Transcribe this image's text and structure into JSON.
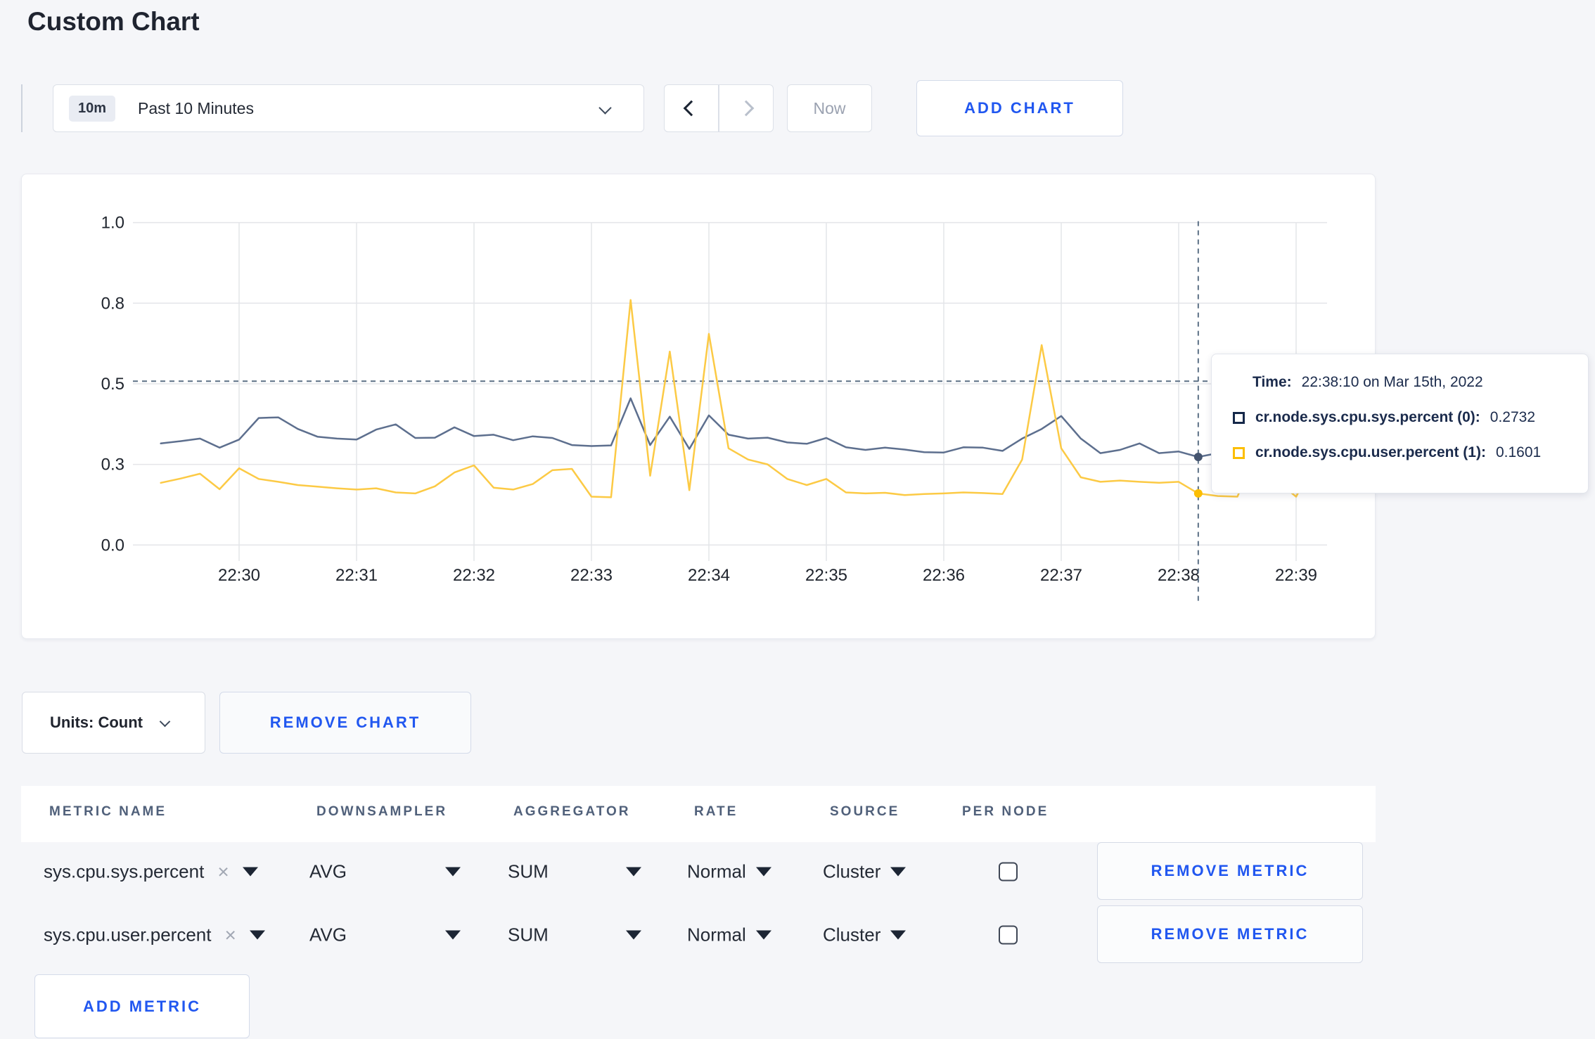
{
  "page": {
    "title": "Custom Chart"
  },
  "toolbar": {
    "time_badge": "10m",
    "time_label": "Past 10 Minutes",
    "now_label": "Now",
    "add_chart_label": "ADD CHART"
  },
  "chart_controls": {
    "units_label": "Units: Count",
    "remove_chart_label": "REMOVE CHART"
  },
  "tooltip": {
    "time_label": "Time:",
    "time_value": "22:38:10 on Mar 15th, 2022",
    "series": [
      {
        "name": "cr.node.sys.cpu.sys.percent (0):",
        "value": "0.2732",
        "color": "#152849"
      },
      {
        "name": "cr.node.sys.cpu.user.percent (1):",
        "value": "0.1601",
        "color": "#fcbe03"
      }
    ]
  },
  "metrics_table": {
    "headers": [
      "METRIC NAME",
      "DOWNSAMPLER",
      "AGGREGATOR",
      "RATE",
      "SOURCE",
      "PER NODE"
    ],
    "rows": [
      {
        "name": "sys.cpu.sys.percent",
        "remove_icon": "×",
        "downsampler": "AVG",
        "aggregator": "SUM",
        "rate": "Normal",
        "source": "Cluster",
        "per_node_checked": false,
        "remove_label": "REMOVE METRIC"
      },
      {
        "name": "sys.cpu.user.percent",
        "remove_icon": "×",
        "downsampler": "AVG",
        "aggregator": "SUM",
        "rate": "Normal",
        "source": "Cluster",
        "per_node_checked": false,
        "remove_label": "REMOVE METRIC"
      }
    ],
    "add_metric_label": "ADD METRIC"
  },
  "chart_data": {
    "type": "line",
    "title": "",
    "x_start_time": "22:29:20",
    "x_interval_seconds": 10,
    "x_tick_labels": [
      "22:30",
      "22:31",
      "22:32",
      "22:33",
      "22:34",
      "22:35",
      "22:36",
      "22:37",
      "22:38",
      "22:39"
    ],
    "y_tick_labels": [
      "0.0",
      "0.3",
      "0.5",
      "0.8",
      "1.0"
    ],
    "y_tick_values": [
      0,
      0.25,
      0.5,
      0.75,
      1.0
    ],
    "ylim": [
      0,
      1
    ],
    "grid": true,
    "legend_position": "tooltip-only",
    "series": [
      {
        "name": "cr.node.sys.cpu.sys.percent",
        "color": "#5d6f8e",
        "dot_color": "#44546f",
        "values": [
          0.315,
          0.322,
          0.33,
          0.302,
          0.327,
          0.394,
          0.396,
          0.36,
          0.336,
          0.33,
          0.327,
          0.358,
          0.374,
          0.332,
          0.333,
          0.365,
          0.338,
          0.342,
          0.325,
          0.337,
          0.332,
          0.31,
          0.307,
          0.309,
          0.455,
          0.31,
          0.398,
          0.298,
          0.402,
          0.342,
          0.33,
          0.333,
          0.318,
          0.314,
          0.332,
          0.303,
          0.295,
          0.302,
          0.296,
          0.288,
          0.287,
          0.303,
          0.302,
          0.292,
          0.33,
          0.36,
          0.4,
          0.33,
          0.285,
          0.295,
          0.315,
          0.285,
          0.29,
          0.2732,
          0.285,
          0.29,
          0.295,
          0.285,
          0.28,
          0.285
        ]
      },
      {
        "name": "cr.node.sys.cpu.user.percent",
        "color": "#fcca45",
        "dot_color": "#fcbe03",
        "values": [
          0.193,
          0.206,
          0.221,
          0.173,
          0.238,
          0.205,
          0.196,
          0.186,
          0.181,
          0.176,
          0.172,
          0.176,
          0.163,
          0.16,
          0.182,
          0.225,
          0.247,
          0.178,
          0.172,
          0.189,
          0.232,
          0.236,
          0.15,
          0.148,
          0.76,
          0.215,
          0.6,
          0.17,
          0.655,
          0.3,
          0.265,
          0.25,
          0.205,
          0.186,
          0.205,
          0.163,
          0.16,
          0.162,
          0.155,
          0.158,
          0.16,
          0.163,
          0.161,
          0.158,
          0.265,
          0.62,
          0.3,
          0.21,
          0.196,
          0.2,
          0.196,
          0.193,
          0.196,
          0.1601,
          0.152,
          0.15,
          0.29,
          0.2,
          0.15,
          0.265
        ]
      }
    ],
    "crosshair": {
      "time": "22:38:10",
      "index": 53,
      "hover_y_value": 0.508,
      "series_values": [
        0.2732,
        0.1601
      ]
    }
  }
}
